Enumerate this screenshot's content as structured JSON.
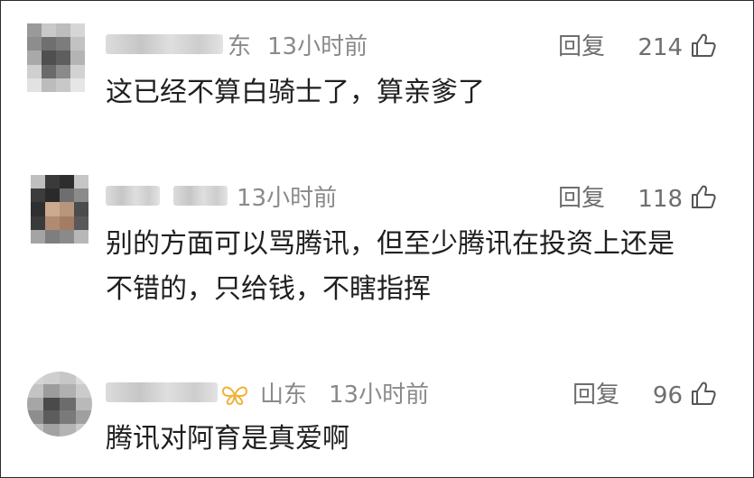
{
  "comments": [
    {
      "location": "东",
      "time": "13小时前",
      "reply_label": "回复",
      "likes": "214",
      "lines": [
        "这已经不算白骑士了，算亲爹了"
      ]
    },
    {
      "location": "",
      "time": "13小时前",
      "reply_label": "回复",
      "likes": "118",
      "lines": [
        "别的方面可以骂腾讯，但至少腾讯在投资上还是",
        "不错的，只给钱，不瞎指挥"
      ]
    },
    {
      "location": "山东",
      "time": "13小时前",
      "reply_label": "回复",
      "likes": "96",
      "lines": [
        "腾讯对阿育是真爱啊"
      ]
    }
  ],
  "icons": {
    "like": "thumbs-up-icon",
    "badge": "butterfly-badge-icon"
  },
  "colors": {
    "meta_text": "#8a8a8a",
    "body_text": "#1f1f1f",
    "badge": "#f0b23a"
  }
}
